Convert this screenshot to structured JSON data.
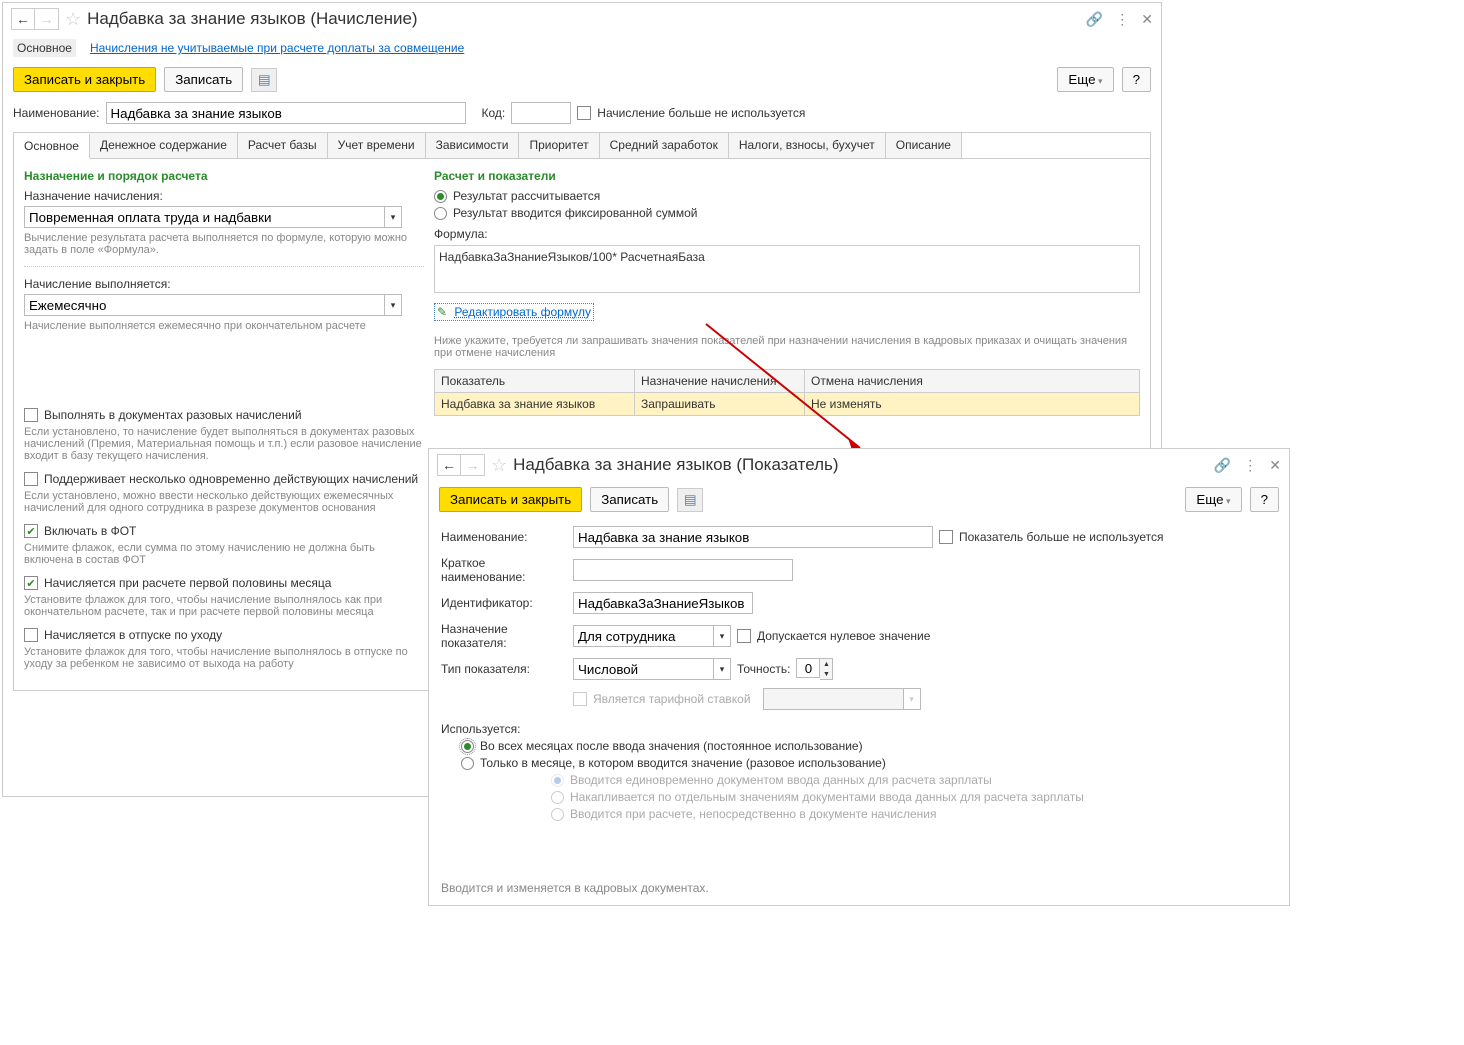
{
  "w1": {
    "title": "Надбавка за знание языков (Начисление)",
    "subnav": {
      "main": "Основное",
      "link": "Начисления не учитываемые при расчете доплаты за совмещение"
    },
    "toolbar": {
      "save_close": "Записать и закрыть",
      "save": "Записать",
      "more": "Еще",
      "help": "?"
    },
    "name_label": "Наименование:",
    "name_value": "Надбавка за знание языков",
    "code_label": "Код:",
    "unused_label": "Начисление больше не используется",
    "tabs": [
      "Основное",
      "Денежное содержание",
      "Расчет базы",
      "Учет времени",
      "Зависимости",
      "Приоритет",
      "Средний заработок",
      "Налоги, взносы, бухучет",
      "Описание"
    ],
    "left": {
      "section1": "Назначение и порядок расчета",
      "purpose_label": "Назначение начисления:",
      "purpose_value": "Повременная оплата труда и надбавки",
      "purpose_hint": "Вычисление результата расчета выполняется по формуле, которую можно задать в поле «Формула».",
      "exec_label": "Начисление выполняется:",
      "exec_value": "Ежемесячно",
      "exec_hint": "Начисление выполняется ежемесячно при окончательном расчете",
      "cb1": "Выполнять в документах разовых начислений",
      "cb1_hint": "Если установлено, то начисление будет выполняться в документах разовых начислений (Премия, Материальная помощь и т.п.) если разовое начисление входит в базу текущего начисления.",
      "cb2": "Поддерживает несколько одновременно действующих начислений",
      "cb2_hint": "Если установлено, можно ввести несколько действующих ежемесячных начислений для одного сотрудника в разрезе документов основания",
      "cb3": "Включать в ФОТ",
      "cb3_hint": "Снимите флажок, если сумма по этому начислению не должна быть включена в состав ФОТ",
      "cb4": "Начисляется при расчете первой половины месяца",
      "cb4_hint": "Установите флажок для того, чтобы начисление выполнялось как при окончательном расчете, так и при расчете первой половины месяца",
      "cb5": "Начисляется в отпуске по уходу",
      "cb5_hint": "Установите флажок для того, чтобы начисление выполнялось в отпуске по уходу за ребенком не зависимо от выхода на работу"
    },
    "right": {
      "section": "Расчет и показатели",
      "r1": "Результат рассчитывается",
      "r2": "Результат вводится фиксированной суммой",
      "formula_label": "Формула:",
      "formula": "НадбавкаЗаЗнаниеЯзыков/100* РасчетнаяБаза",
      "edit_link": "Редактировать формулу",
      "table_hint": "Ниже укажите, требуется ли запрашивать значения показателей при назначении начисления в кадровых приказах и очищать значения при отмене начисления",
      "th1": "Показатель",
      "th2": "Назначение начисления",
      "th3": "Отмена начисления",
      "td1": "Надбавка за знание языков",
      "td2": "Запрашивать",
      "td3": "Не изменять"
    }
  },
  "w2": {
    "title": "Надбавка за знание языков (Показатель)",
    "toolbar": {
      "save_close": "Записать и закрыть",
      "save": "Записать",
      "more": "Еще",
      "help": "?"
    },
    "name_label": "Наименование:",
    "name_value": "Надбавка за знание языков",
    "unused_label": "Показатель больше не используется",
    "short_label": "Краткое наименование:",
    "id_label": "Идентификатор:",
    "id_value": "НадбавкаЗаЗнаниеЯзыков",
    "purpose_label": "Назначение показателя:",
    "purpose_value": "Для сотрудника",
    "allow_zero": "Допускается нулевое значение",
    "type_label": "Тип показателя:",
    "type_value": "Числовой",
    "precision_label": "Точность:",
    "precision_value": "0",
    "tariff_label": "Является тарифной ставкой",
    "usage_label": "Используется:",
    "u1": "Во всех месяцах после ввода значения (постоянное использование)",
    "u2": "Только в месяце, в котором вводится значение (разовое использование)",
    "u2a": "Вводится единовременно документом ввода данных для расчета зарплаты",
    "u2b": "Накапливается по отдельным значениям документами ввода данных для расчета зарплаты",
    "u2c": "Вводится при расчете, непосредственно в документе начисления",
    "bottom": "Вводится и изменяется в кадровых документах."
  }
}
